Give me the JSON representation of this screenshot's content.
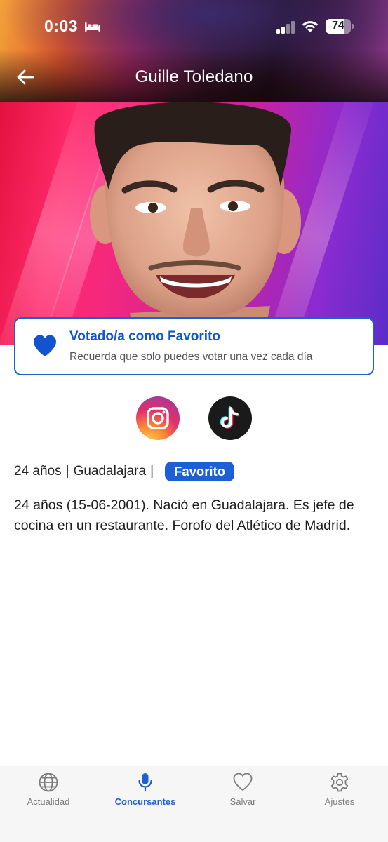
{
  "status_bar": {
    "time": "0:03",
    "battery": "74",
    "icons": [
      "bed-icon",
      "signal-icon",
      "wifi-icon",
      "battery-icon"
    ]
  },
  "header": {
    "title": "Guille Toledano",
    "back_icon": "arrow-left-icon"
  },
  "vote_card": {
    "icon": "heart-icon",
    "title": "Votado/a como Favorito",
    "subtitle": "Recuerda que solo puedes votar una vez cada día",
    "accent_color": "#1c5fd6"
  },
  "social": [
    {
      "name": "instagram",
      "icon": "instagram-icon"
    },
    {
      "name": "tiktok",
      "icon": "tiktok-icon"
    }
  ],
  "profile": {
    "age": "24 años",
    "separator": "|",
    "city": "Guadalajara",
    "badge": "Favorito",
    "bio": "24 años (15-06-2001). Nació en Guadalajara. Es jefe de cocina en un restaurante. Forofo del Atlético de Madrid."
  },
  "tab_bar": {
    "active_color": "#1c5fd6",
    "items": [
      {
        "label": "Actualidad",
        "icon": "globe-icon",
        "active": false
      },
      {
        "label": "Concursantes",
        "icon": "microphone-icon",
        "active": true
      },
      {
        "label": "Salvar",
        "icon": "heart-outline-icon",
        "active": false
      },
      {
        "label": "Ajustes",
        "icon": "gear-icon",
        "active": false
      }
    ]
  }
}
